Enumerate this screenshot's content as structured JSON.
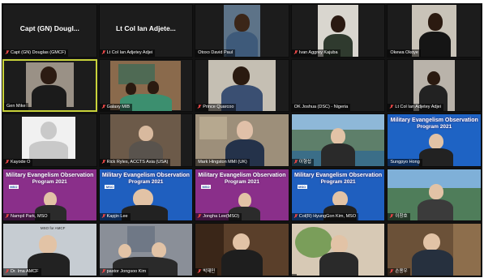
{
  "tiles": [
    {
      "name": "Capt (GN) Douglas (GMCF)",
      "big": "Capt (GN) Dougl...",
      "muted": true
    },
    {
      "name": "Lt Col Ian Adjetey Adjei",
      "big": "Lt Col Ian Adjete...",
      "muted": true
    },
    {
      "name": "Otoxo David Paul",
      "muted": false
    },
    {
      "name": "Ivan Aggrey Kajuba",
      "muted": true
    },
    {
      "name": "Okewa Okoye",
      "muted": false
    },
    {
      "name": "Gen Mike",
      "muted": false,
      "active": true
    },
    {
      "name": "Galaxy MIB",
      "muted": true
    },
    {
      "name": "Prince Quarcoo",
      "muted": true
    },
    {
      "name": "OK Joshua  (DSC) - Nigeria",
      "muted": false
    },
    {
      "name": "Lt Col Ian Adjetey Adjei",
      "muted": true
    },
    {
      "name": "Kayode O",
      "muted": true
    },
    {
      "name": "Rick Ryles, ACCTS Asia (USA)",
      "muted": true
    },
    {
      "name": "Mark Hingston MMI (UK)",
      "muted": false
    },
    {
      "name": "이형섭",
      "muted": true
    },
    {
      "name": "Sungpyo Hong",
      "muted": false
    },
    {
      "name": "Nampil Park, MSO",
      "muted": true
    },
    {
      "name": "Kapjin Lee",
      "muted": true
    },
    {
      "name": "Jongha Lee(MSO)",
      "muted": true
    },
    {
      "name": "Col(R) HyungGon Kim, MSO",
      "muted": true
    },
    {
      "name": "이창호",
      "muted": true
    },
    {
      "name": "Dr. Ima AMCF",
      "muted": true
    },
    {
      "name": "pastor Jongsoo Kim",
      "muted": true
    },
    {
      "name": "박재민",
      "muted": true
    },
    {
      "name": "",
      "muted": false
    },
    {
      "name": "손용우",
      "muted": true
    }
  ],
  "banner": {
    "line1": "Military Evangelism Observation",
    "line2": "Program 2021",
    "logo": "MSO"
  },
  "map_caption": "MSO for AMCF"
}
